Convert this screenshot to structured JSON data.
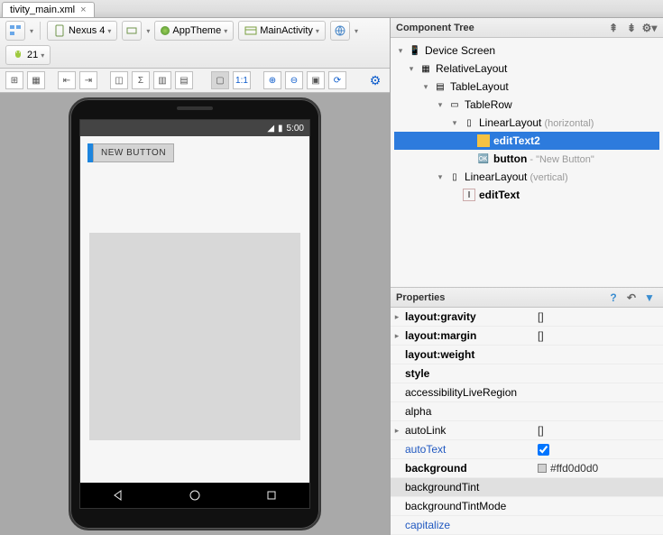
{
  "tabs": {
    "active": "tivity_main.xml"
  },
  "toolbar": {
    "device": "Nexus 4",
    "theme": "AppTheme",
    "activity": "MainActivity",
    "api": "21"
  },
  "phone": {
    "clock": "5:00",
    "button_label": "NEW BUTTON"
  },
  "panels": {
    "tree_title": "Component Tree",
    "props_title": "Properties"
  },
  "tree": {
    "root": "Device Screen",
    "rel": "RelativeLayout",
    "table": "TableLayout",
    "row": "TableRow",
    "lin_h": "LinearLayout",
    "lin_h_hint": " (horizontal)",
    "et2": "editText2",
    "btn": "button",
    "btn_hint": " - \"New Button\"",
    "lin_v": "LinearLayout",
    "lin_v_hint": " (vertical)",
    "et": "editText"
  },
  "properties": [
    {
      "name": "layout:gravity",
      "value": "[]",
      "bold": true,
      "expander": true
    },
    {
      "name": "layout:margin",
      "value": "[]",
      "bold": true,
      "expander": true
    },
    {
      "name": "layout:weight",
      "value": "",
      "bold": true
    },
    {
      "name": "style",
      "value": "",
      "bold": true
    },
    {
      "name": "accessibilityLiveRegion",
      "value": ""
    },
    {
      "name": "alpha",
      "value": ""
    },
    {
      "name": "autoLink",
      "value": "[]",
      "expander": true
    },
    {
      "name": "autoText",
      "value": "",
      "link": true,
      "check": true
    },
    {
      "name": "background",
      "value": "#ffd0d0d0",
      "bold": true,
      "swatch": "#d0d0d0"
    },
    {
      "name": "backgroundTint",
      "value": "",
      "selected": true
    },
    {
      "name": "backgroundTintMode",
      "value": ""
    },
    {
      "name": "capitalize",
      "value": "",
      "link": true
    }
  ]
}
